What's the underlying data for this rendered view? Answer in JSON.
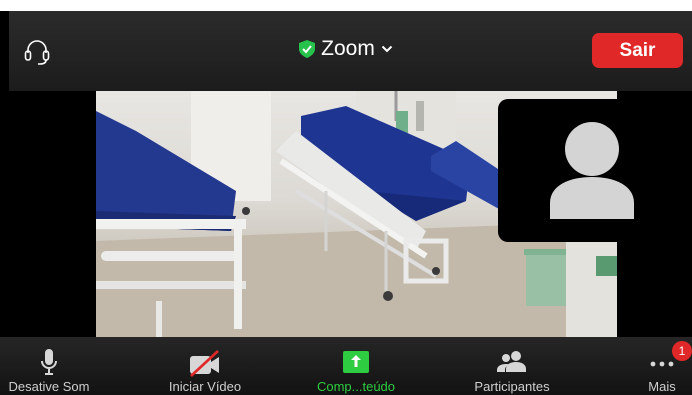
{
  "header": {
    "title": "Zoom",
    "leave_label": "Sair"
  },
  "toolbar": {
    "items": [
      {
        "label": "Desative Som",
        "icon": "microphone-icon"
      },
      {
        "label": "Iniciar Vídeo",
        "icon": "video-off-icon"
      },
      {
        "label": "Comp...teúdo",
        "icon": "share-content-icon"
      },
      {
        "label": "Participantes",
        "icon": "participants-icon"
      },
      {
        "label": "Mais",
        "icon": "more-icon"
      }
    ],
    "more_badge": "1"
  },
  "colors": {
    "leave": "#e02828",
    "share": "#2ecc40",
    "shield": "#27c24c"
  }
}
